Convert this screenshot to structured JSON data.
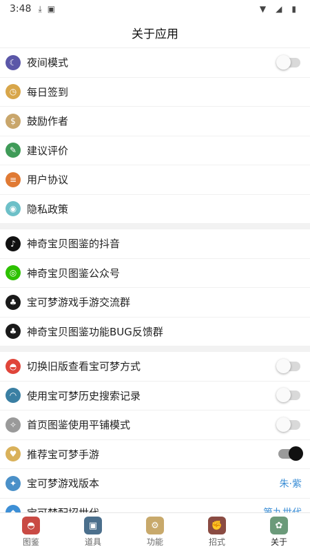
{
  "status": {
    "time": "3:48"
  },
  "title": "关于应用",
  "section1": [
    {
      "label": "夜间模式",
      "icon": "night-mode-icon",
      "color": "#5b57a8",
      "glyph": "☾",
      "toggle": "off"
    },
    {
      "label": "每日签到",
      "icon": "clock-icon",
      "color": "#d8a64a",
      "glyph": "◷"
    },
    {
      "label": "鼓励作者",
      "icon": "money-bag-icon",
      "color": "#c9a66b",
      "glyph": "$"
    },
    {
      "label": "建议评价",
      "icon": "feedback-icon",
      "color": "#3f9b58",
      "glyph": "✎"
    },
    {
      "label": "用户协议",
      "icon": "agreement-icon",
      "color": "#e07a34",
      "glyph": "≡"
    },
    {
      "label": "隐私政策",
      "icon": "privacy-icon",
      "color": "#6dc0c8",
      "glyph": "◉"
    }
  ],
  "section2": [
    {
      "label": "神奇宝贝图鉴的抖音",
      "icon": "tiktok-icon",
      "color": "#111111",
      "glyph": "♪"
    },
    {
      "label": "神奇宝贝图鉴公众号",
      "icon": "wechat-icon",
      "color": "#2dc100",
      "glyph": "◎"
    },
    {
      "label": "宝可梦游戏手游交流群",
      "icon": "qq-icon",
      "color": "#1a1a1a",
      "glyph": "♣"
    },
    {
      "label": "神奇宝贝图鉴功能BUG反馈群",
      "icon": "qq-icon",
      "color": "#1a1a1a",
      "glyph": "♣"
    }
  ],
  "section3": [
    {
      "label": "切换旧版查看宝可梦方式",
      "icon": "pokeball-icon",
      "color": "#e0453a",
      "glyph": "◓",
      "toggle": "off"
    },
    {
      "label": "使用宝可梦历史搜索记录",
      "icon": "snorlax-icon",
      "color": "#3a7fa3",
      "glyph": "◠",
      "toggle": "off"
    },
    {
      "label": "首页图鉴使用平铺模式",
      "icon": "feather-icon",
      "color": "#9a9a9a",
      "glyph": "✧",
      "toggle": "off"
    },
    {
      "label": "推荐宝可梦手游",
      "icon": "meowth-icon",
      "color": "#d9b15a",
      "glyph": "♥",
      "toggle": "on"
    },
    {
      "label": "宝可梦游戏版本",
      "icon": "version-icon",
      "color": "#4a90c8",
      "glyph": "✦",
      "value": "朱·紫"
    },
    {
      "label": "宝可梦配招世代",
      "icon": "generation-icon",
      "color": "#3d8fd6",
      "glyph": "◆",
      "value": "第九世代"
    }
  ],
  "nav": [
    {
      "label": "图鉴",
      "icon": "pokedex-icon",
      "color": "#c94a44",
      "glyph": "◓"
    },
    {
      "label": "道具",
      "icon": "bag-icon",
      "color": "#4b6f8c",
      "glyph": "▣"
    },
    {
      "label": "功能",
      "icon": "function-icon",
      "color": "#c8a96b",
      "glyph": "⚙"
    },
    {
      "label": "招式",
      "icon": "moves-icon",
      "color": "#8a4b42",
      "glyph": "✊"
    },
    {
      "label": "关于",
      "icon": "about-icon",
      "color": "#6b9a7a",
      "glyph": "✿",
      "active": true
    }
  ]
}
